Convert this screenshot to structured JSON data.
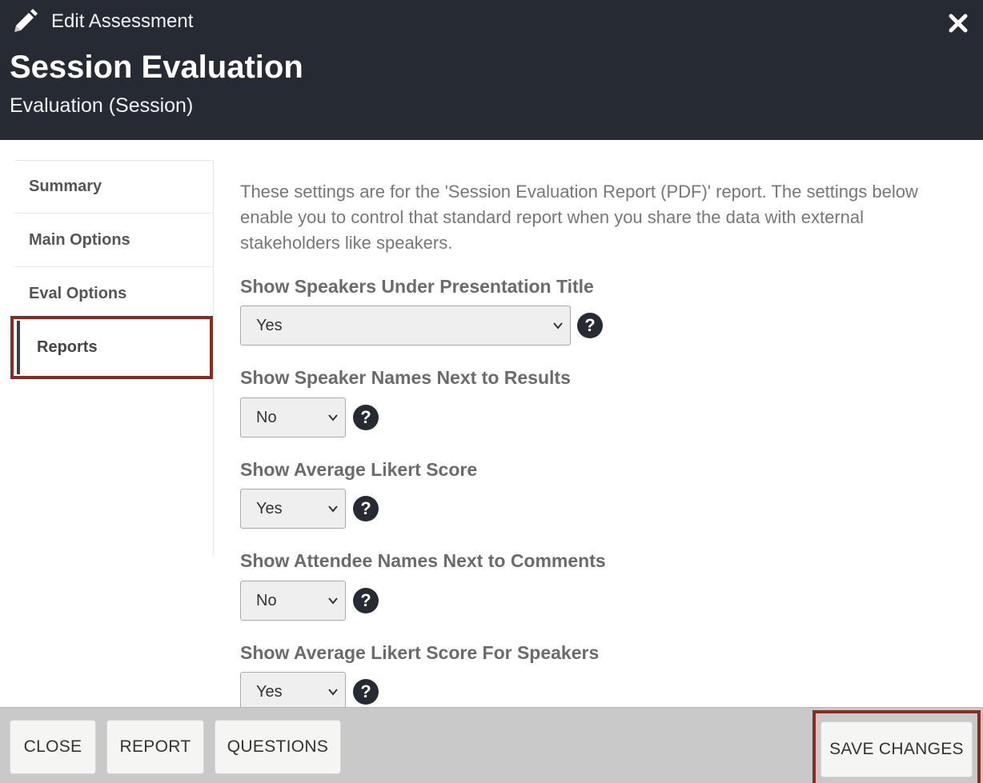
{
  "header": {
    "edit_label": "Edit Assessment",
    "title": "Session Evaluation",
    "subtitle": "Evaluation (Session)",
    "edit_icon": "pencil-icon",
    "close_icon": "close-icon"
  },
  "sidebar": {
    "items": [
      {
        "label": "Summary"
      },
      {
        "label": "Main Options"
      },
      {
        "label": "Eval Options"
      },
      {
        "label": "Reports"
      }
    ],
    "active": "Reports"
  },
  "content": {
    "intro": "These settings are for the 'Session Evaluation Report (PDF)' report. The settings below enable you to control that standard report when you share the data with external stakeholders like speakers.",
    "fields": [
      {
        "label": "Show Speakers Under Presentation Title",
        "value": "Yes"
      },
      {
        "label": "Show Speaker Names Next to Results",
        "value": "No"
      },
      {
        "label": "Show Average Likert Score",
        "value": "Yes"
      },
      {
        "label": "Show Attendee Names Next to Comments",
        "value": "No"
      },
      {
        "label": "Show Average Likert Score For Speakers",
        "value": "Yes"
      }
    ],
    "help_glyph": "?"
  },
  "footer": {
    "close_label": "CLOSE",
    "report_label": "REPORT",
    "questions_label": "QUESTIONS",
    "save_label": "SAVE CHANGES"
  },
  "colors": {
    "header_bg": "#262a33",
    "highlight": "#8b2b1f",
    "footer_bg": "#c9c9c9"
  }
}
